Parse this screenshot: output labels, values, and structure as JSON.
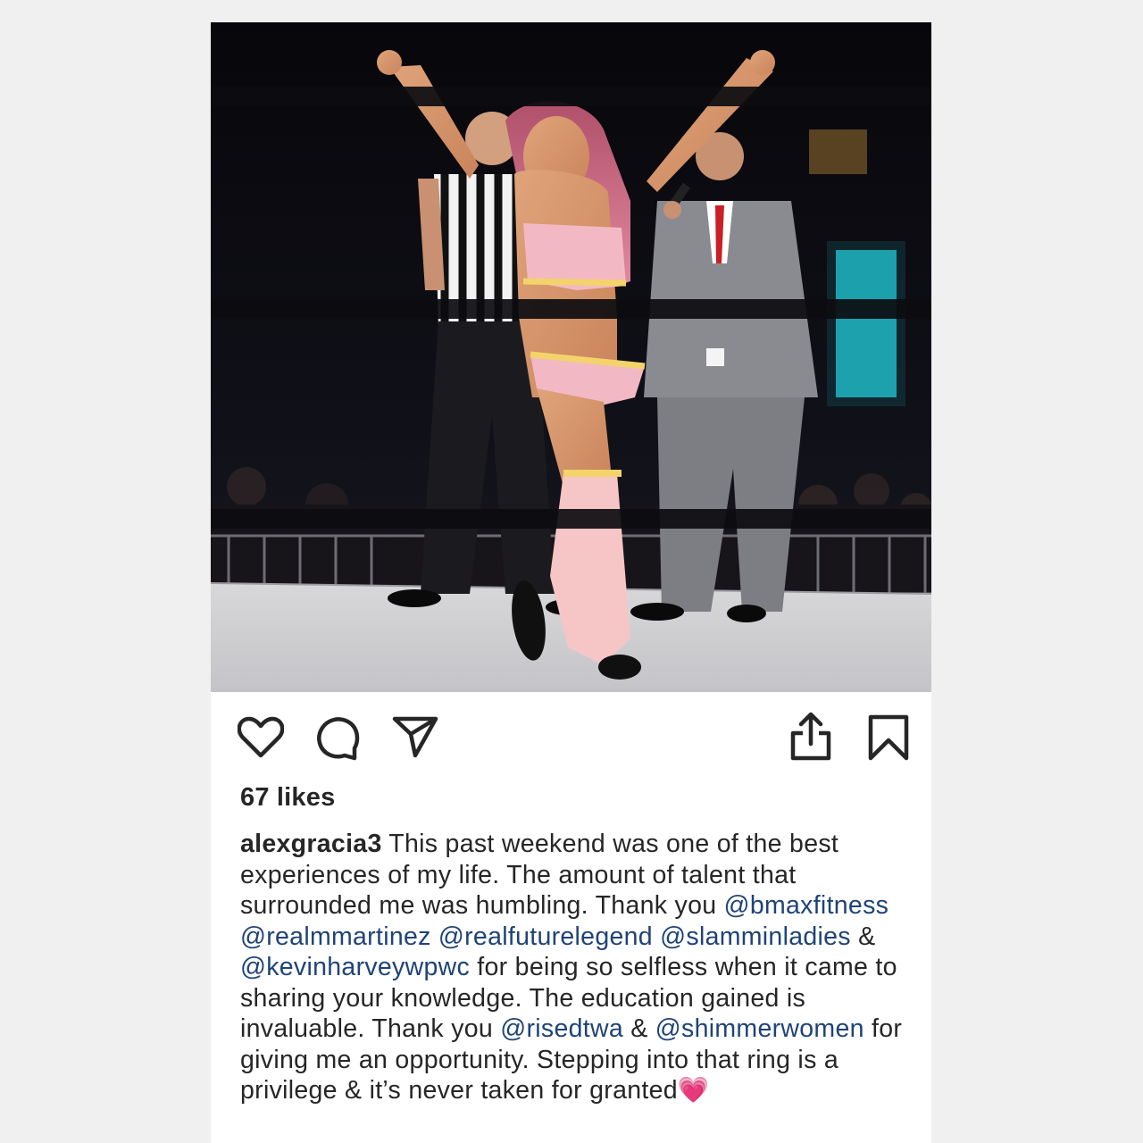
{
  "post": {
    "photo": {
      "icon": "wrestling-ring-photo"
    },
    "actions": [
      {
        "name": "like-button",
        "icon": "heart-icon"
      },
      {
        "name": "comment-button",
        "icon": "comment-icon"
      },
      {
        "name": "share-button",
        "icon": "paper-plane-icon"
      },
      {
        "name": "upload-button",
        "icon": "share-up-icon"
      },
      {
        "name": "save-button",
        "icon": "bookmark-icon"
      }
    ],
    "likes_text": "67 likes",
    "caption": {
      "username": "alexgracia3",
      "text_1": " This past weekend was one of the best experiences of my life. The amount of talent that surrounded me was humbling. Thank you ",
      "mention_1": "@bmaxfitness",
      "sep_1": " ",
      "mention_2": "@realmmartinez",
      "sep_2": " ",
      "mention_3": "@realfuturelegend",
      "sep_3": " ",
      "mention_4": "@slamminladies",
      "sep_4": " & ",
      "mention_5": "@kevinharveywpwc",
      "text_2": " for being so selfless when it came to sharing your knowledge. The education gained is invaluable. Thank you ",
      "mention_6": "@risedtwa",
      "sep_5": " & ",
      "mention_7": "@shimmerwomen",
      "text_3": " for giving me an opportunity. Stepping into that ring is a privilege & it’s never taken for granted",
      "emoji": "💗"
    },
    "colors": {
      "text": "#262626",
      "mention": "#1f4377",
      "background": "#f0f0f0"
    }
  }
}
